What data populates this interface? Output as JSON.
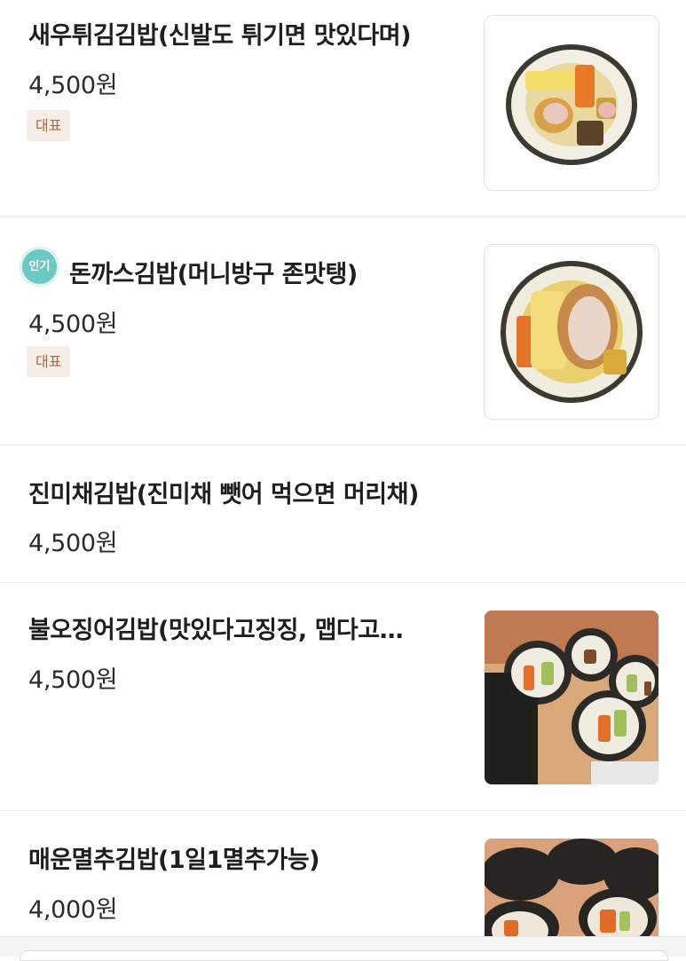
{
  "items": [
    {
      "name": "새우튀김김밥(신발도 튀기면 맛있다며)",
      "price": "4,500원",
      "badge": "대표"
    },
    {
      "name": "돈까스김밥(머니방구 존맛탱)",
      "price": "4,500원",
      "badge": "대표",
      "popular_label": "인기"
    },
    {
      "name": "진미채김밥(진미채 뺏어 먹으면 머리채)",
      "price": "4,500원"
    },
    {
      "name": "불오징어김밥(맛있다고징징, 맵다고…",
      "price": "4,500원"
    },
    {
      "name": "매운멸추김밥(1일1멸추가능)",
      "price": "4,000원"
    }
  ]
}
